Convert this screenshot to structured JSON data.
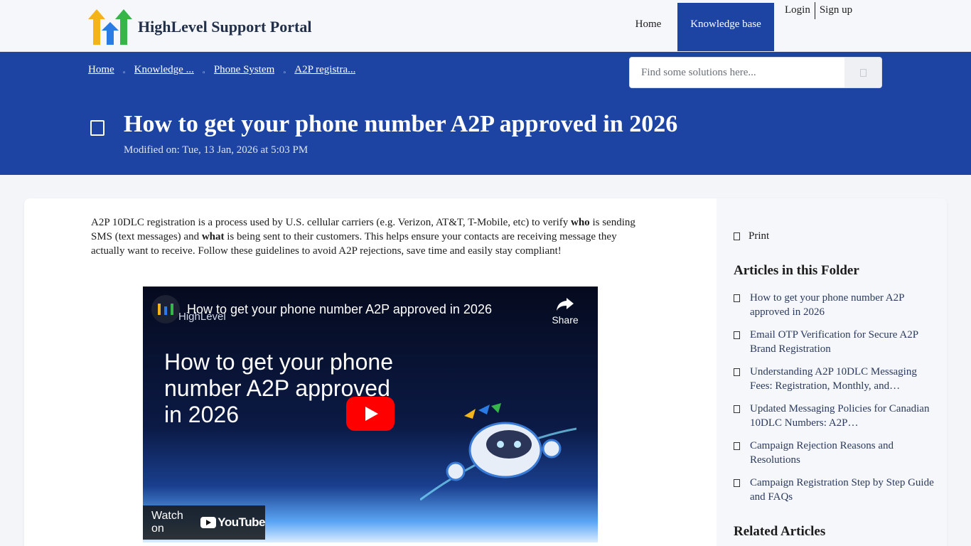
{
  "header": {
    "brand": "HighLevel Support Portal",
    "nav": {
      "home": "Home",
      "knowledge_base": "Knowledge base"
    },
    "auth": {
      "login": "Login",
      "signup": "Sign up"
    }
  },
  "breadcrumb": [
    "Home",
    "Knowledge ...",
    "Phone System",
    "A2P registra..."
  ],
  "search": {
    "placeholder": "Find some solutions here..."
  },
  "article": {
    "title": "How to get your phone number A2P approved in 2026",
    "modified": "Modified on: Tue, 13 Jan, 2026 at 5:03 PM",
    "intro": {
      "p1": "A2P 10DLC registration is a process used by U.S. cellular carriers (e.g. Verizon, AT&T, T-Mobile, etc) to verify ",
      "b1": "who",
      "p2": " is sending SMS (text messages) and ",
      "b2": "what",
      "p3": " is being sent to their customers. This helps ensure your contacts are receiving message they actually want to receive. Follow these guidelines to avoid A2P rejections, save time and easily stay compliant!"
    }
  },
  "video": {
    "title": "How to get your phone number A2P approved in 2026",
    "channel_brand": "HighLevel",
    "share": "Share",
    "thumbnail_text": "How to get your phone number A2P approved in 2026",
    "watch_on": "Watch on",
    "youtube": "YouTube"
  },
  "sidebar": {
    "print": "Print",
    "folder_heading": "Articles in this Folder",
    "articles": [
      "How to get your phone number A2P approved in 2026",
      "Email OTP Verification for Secure A2P Brand Registration",
      "Understanding A2P 10DLC Messaging Fees: Registration, Monthly, and…",
      "Updated Messaging Policies for Canadian 10DLC Numbers: A2P…",
      "Campaign Rejection Reasons and Resolutions",
      "Campaign Registration Step by Step Guide and FAQs"
    ],
    "related_heading": "Related Articles"
  },
  "colors": {
    "primary": "#1e44a3",
    "youtube_red": "#ff0000"
  }
}
